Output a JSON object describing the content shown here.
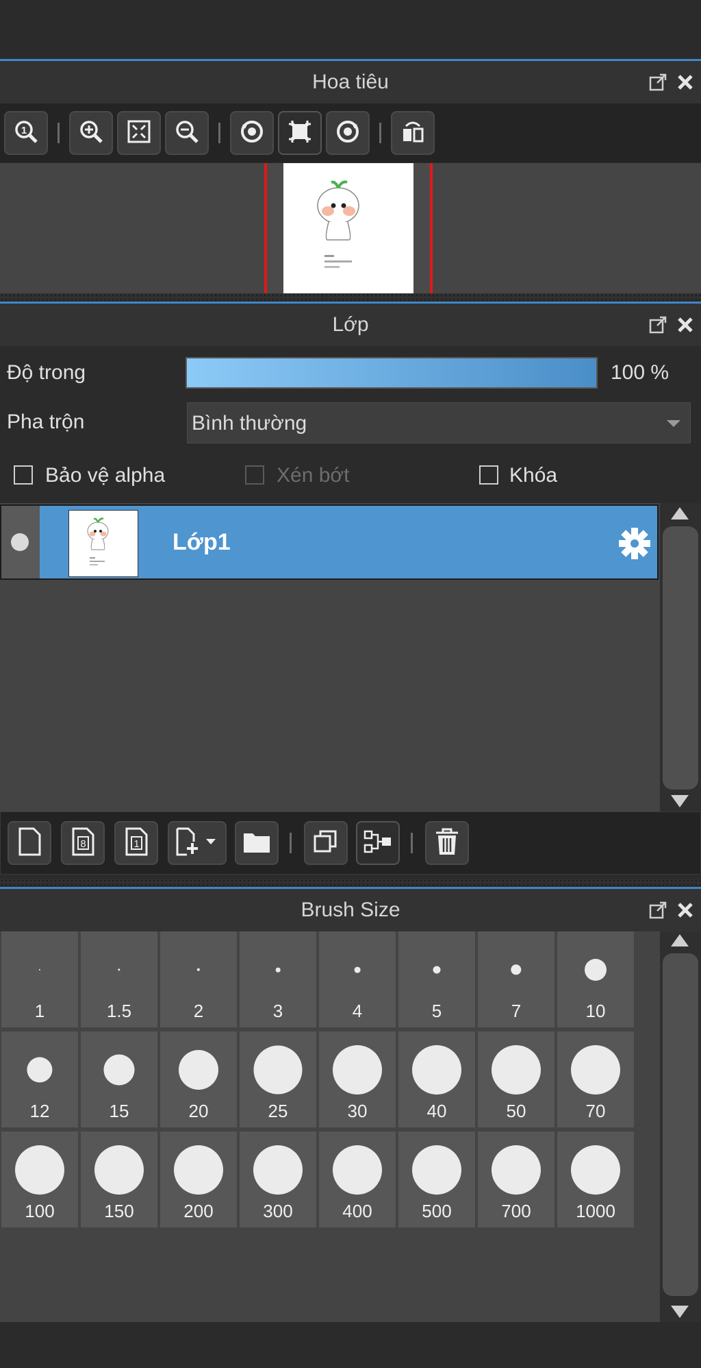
{
  "navigator": {
    "title": "Hoa tiêu",
    "tools": [
      "zoom-actual-icon",
      "zoom-in-icon",
      "fit-icon",
      "zoom-out-icon",
      "rotate-left-icon",
      "reset-rotation-icon",
      "rotate-right-icon",
      "flip-horizontal-icon"
    ]
  },
  "layers": {
    "title": "Lớp",
    "opacity_label": "Độ trong",
    "opacity_value": "100 %",
    "opacity": 1.0,
    "blend_label": "Pha trộn",
    "blend_value": "Bình thường",
    "protect_alpha": "Bảo vệ alpha",
    "clipping": "Xén bớt",
    "lock": "Khóa",
    "items": [
      {
        "name": "Lớp1",
        "selected": true
      }
    ],
    "tools": [
      "new-layer-icon",
      "new-8bit-layer-icon",
      "new-1bit-layer-icon",
      "add-layer-menu-icon",
      "folder-icon",
      "duplicate-icon",
      "merge-down-icon",
      "delete-icon"
    ]
  },
  "brush_size": {
    "title": "Brush Size",
    "sizes": [
      "1",
      "1.5",
      "2",
      "3",
      "4",
      "5",
      "7",
      "10",
      "12",
      "15",
      "20",
      "25",
      "30",
      "40",
      "50",
      "70",
      "100",
      "150",
      "200",
      "300",
      "400",
      "500",
      "700",
      "1000"
    ]
  },
  "colors": {
    "accent": "#3f87c7",
    "selection": "#4f95cf",
    "panel": "#333333"
  }
}
